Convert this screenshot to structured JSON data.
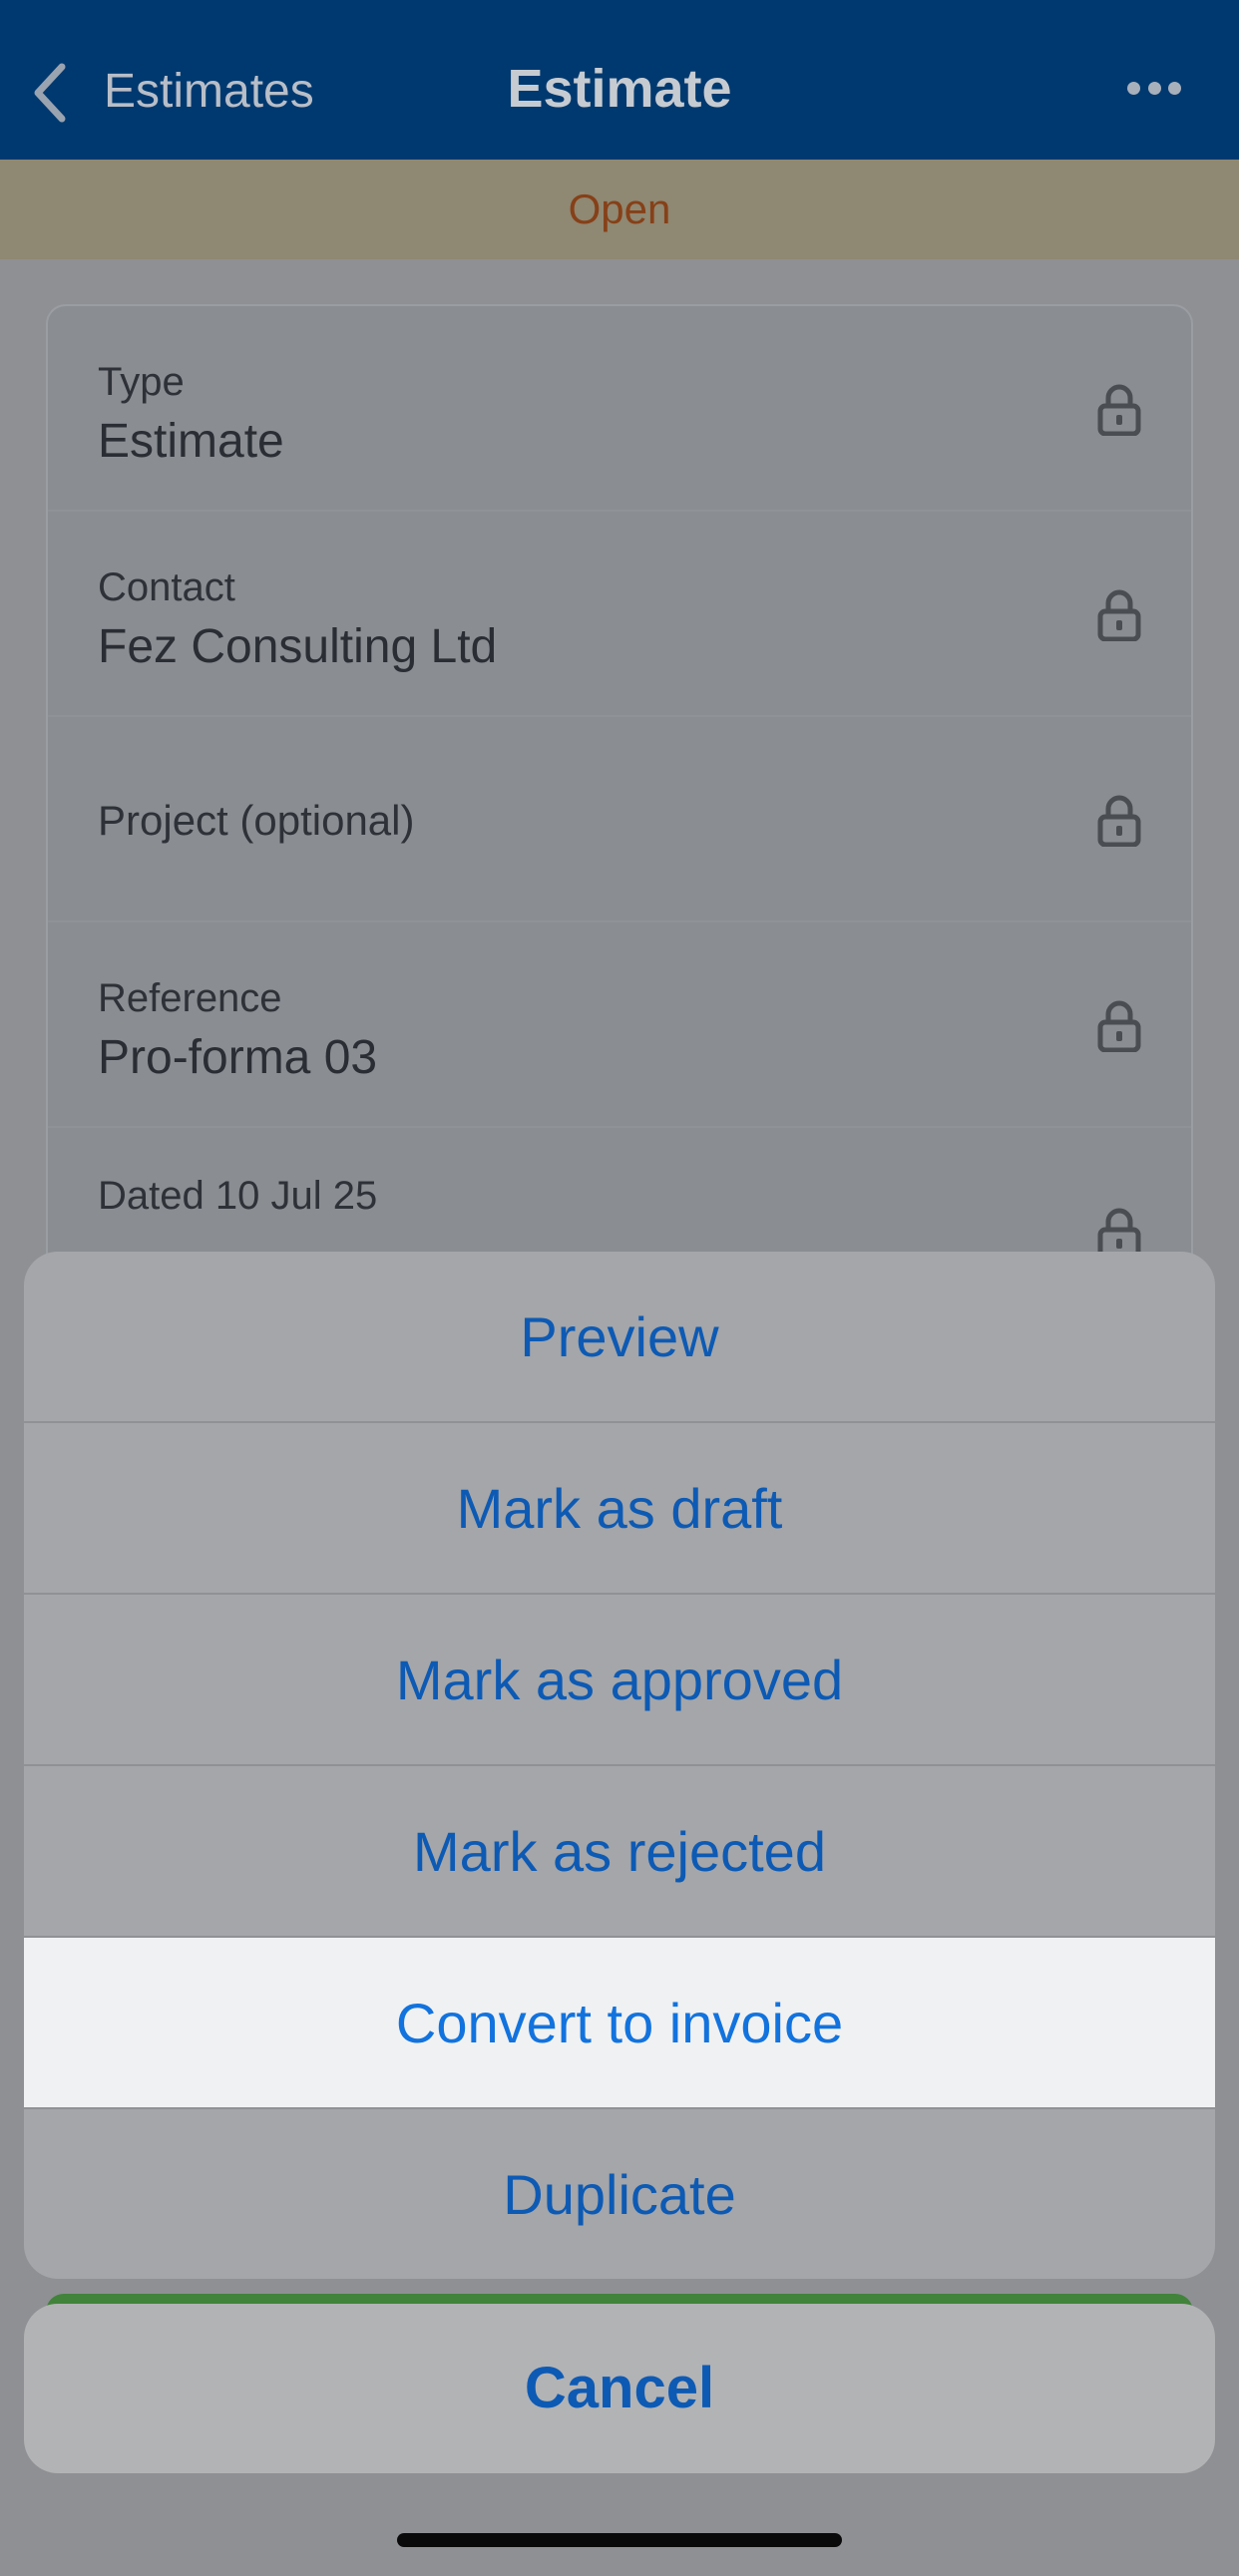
{
  "nav": {
    "back_label": "Estimates",
    "title": "Estimate",
    "back_icon": "chevron-left-icon",
    "more_icon": "ellipsis-icon"
  },
  "status": {
    "label": "Open"
  },
  "fields": [
    {
      "label": "Type",
      "value": "Estimate",
      "icon": "lock-icon"
    },
    {
      "label": "Contact",
      "value": "Fez Consulting Ltd",
      "icon": "lock-icon"
    },
    {
      "label": "Project (optional)",
      "value": "",
      "icon": "lock-icon"
    },
    {
      "label": "Reference",
      "value": "Pro-forma 03",
      "icon": "lock-icon"
    },
    {
      "label": "Dated 10 Jul 25",
      "value": "",
      "icon": "lock-icon"
    }
  ],
  "action_sheet": {
    "actions": [
      {
        "label": "Preview"
      },
      {
        "label": "Mark as draft"
      },
      {
        "label": "Mark as approved"
      },
      {
        "label": "Mark as rejected"
      },
      {
        "label": "Convert to invoice",
        "highlighted": true
      },
      {
        "label": "Duplicate"
      }
    ],
    "cancel_label": "Cancel"
  },
  "colors": {
    "nav_bg": "#00396f",
    "status_bg": "#8f8872",
    "status_text": "#864018",
    "action_text": "#0d5ab4",
    "highlight_bg": "#f0f1f2",
    "success_green": "#41833a"
  }
}
